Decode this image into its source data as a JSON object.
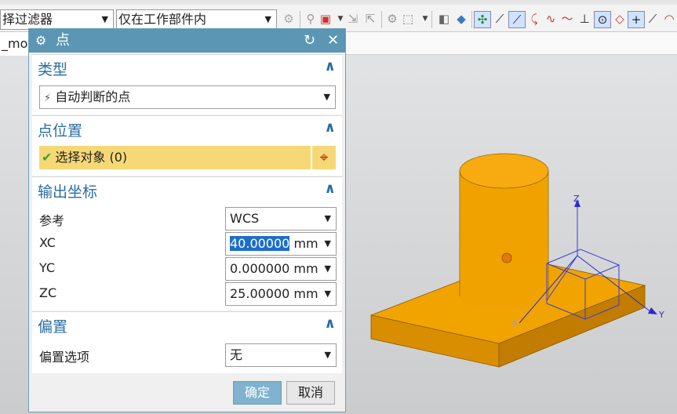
{
  "toolbar": {
    "filter_label": "择过滤器",
    "scope_label": "仅在工作部件内"
  },
  "model_tab": "_mo",
  "dialog": {
    "title": "点",
    "sections": {
      "type": {
        "header": "类型",
        "selected": "自动判断的点"
      },
      "point_location": {
        "header": "点位置",
        "select_object": "选择对象 (0)"
      },
      "output_coords": {
        "header": "输出坐标",
        "reference_label": "参考",
        "reference_value": "WCS",
        "xc_label": "XC",
        "xc_value": "40.00000",
        "xc_unit": "mm",
        "yc_label": "YC",
        "yc_value": "0.000000 mm",
        "zc_label": "ZC",
        "zc_value": "25.00000 mm"
      },
      "offset": {
        "header": "偏置",
        "option_label": "偏置选项",
        "option_value": "无"
      }
    },
    "ok_label": "确定",
    "cancel_label": "取消"
  },
  "viewport": {
    "axis_z": "Z",
    "axis_y": "Y",
    "axis_x": "X",
    "model_color": "#f2a200"
  }
}
